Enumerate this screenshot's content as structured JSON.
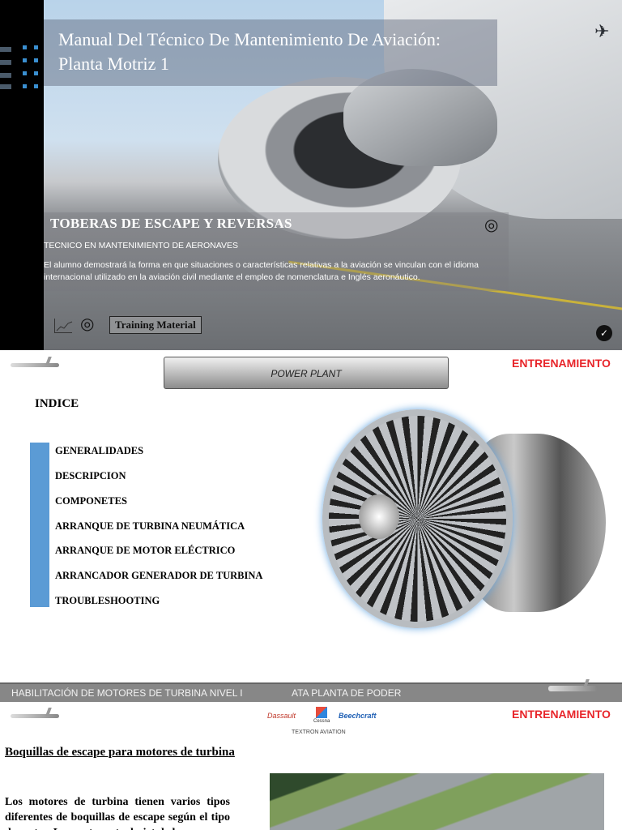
{
  "cover": {
    "title": "Manual Del Técnico De Mantenimiento De Aviación: Planta Motriz 1",
    "subtitle": "TOBERAS DE ESCAPE Y REVERSAS",
    "program": "TECNICO EN MANTENIMIENTO DE AERONAVES",
    "description": "El alumno demostrará la forma en que situaciones o características relativas a la aviación se vinculan con el idioma internacional utilizado en la aviación civil mediante el empleo de nomenclatura e Inglés aeronáutico.",
    "badge": "Training Material",
    "icons": [
      "airplane-icon",
      "target-icon",
      "chart-icon",
      "check-icon"
    ]
  },
  "page2": {
    "banner": "POWER PLANT",
    "brand": "ENTRENAMIENTO",
    "index_title": "INDICE",
    "index_items": [
      "GENERALIDADES",
      "DESCRIPCION",
      "COMPONETES",
      "ARRANQUE DE TURBINA NEUMÁTICA",
      "ARRANQUE DE MOTOR  ELÉCTRICO",
      "ARRANCADOR GENERADOR DE TURBINA",
      "TROUBLESHOOTING"
    ],
    "footer_left": "HABILITACIÓN DE MOTORES DE TURBINA NIVEL I",
    "footer_right": "ATA  PLANTA DE PODER"
  },
  "page3": {
    "brand": "ENTRENAMIENTO",
    "logos": [
      "Dassault",
      "Cessna",
      "Beechcraft",
      "TEXTRON AVIATION"
    ],
    "heading": "Boquillas de escape para motores de turbina",
    "body": "Los motores de turbina tienen varios tipos diferentes de boquillas de escape según el tipo de motor. Los motores turbojet de los"
  },
  "colors": {
    "accent": "#5b9bd5",
    "brand": "#e8262b",
    "footer": "#878787"
  }
}
